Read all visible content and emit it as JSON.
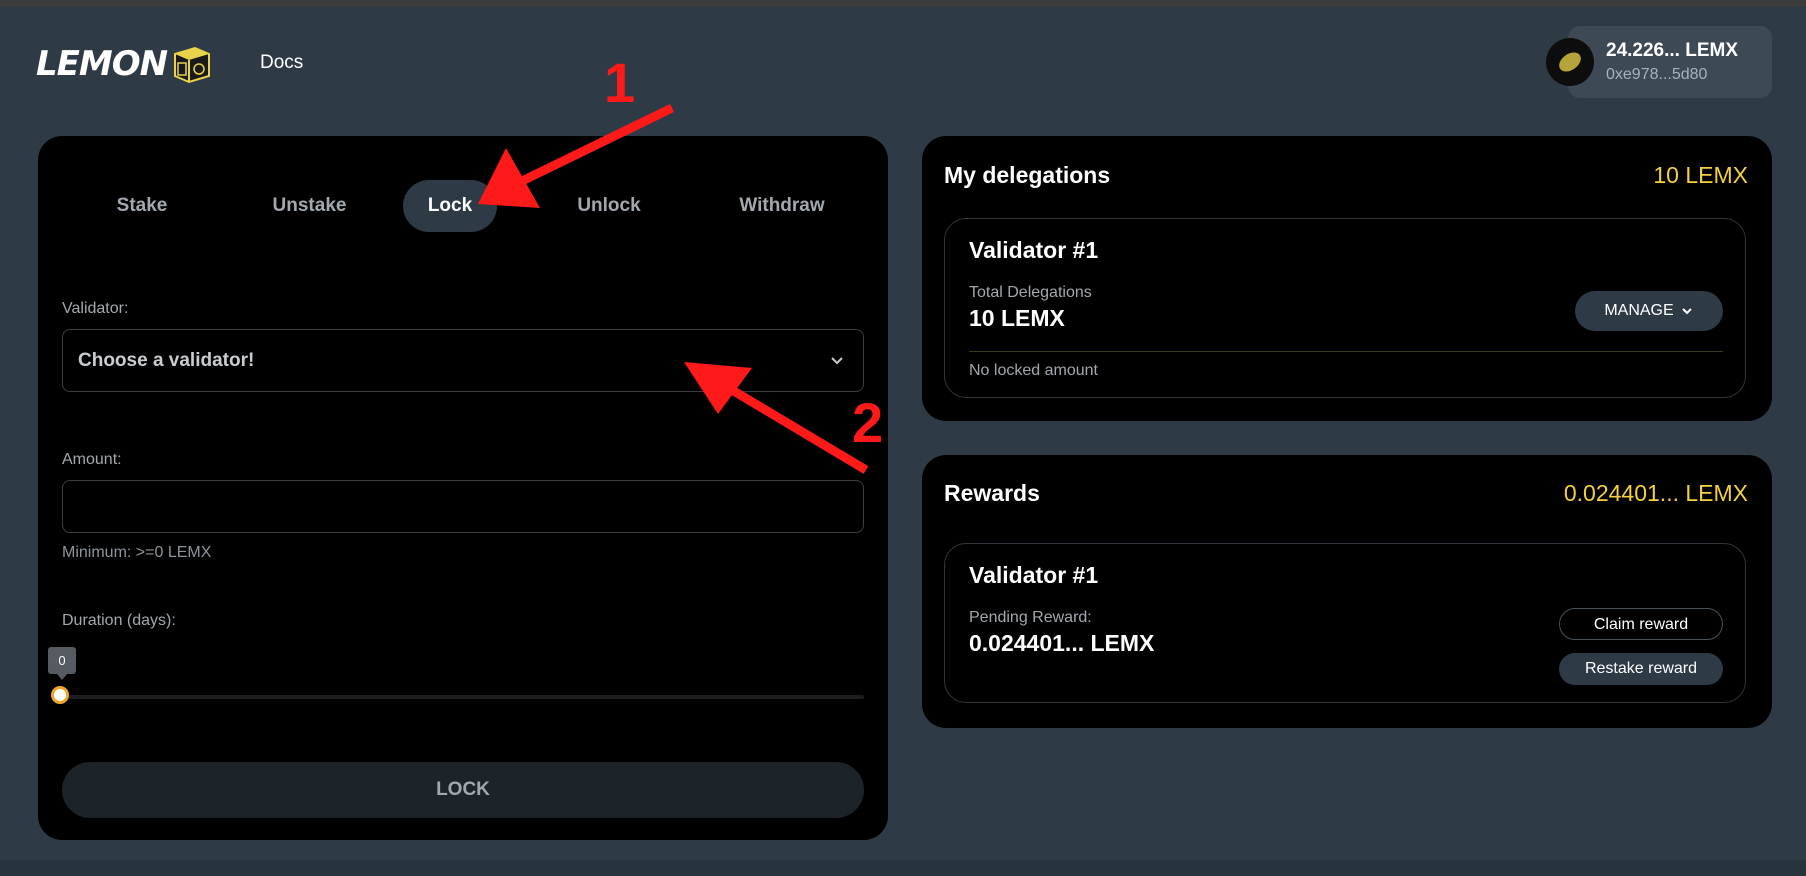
{
  "header": {
    "logo_text": "LEMON",
    "docs_label": "Docs",
    "wallet": {
      "balance": "24.226... LEMX",
      "address": "0xe978...5d80"
    }
  },
  "tabs": [
    {
      "label": "Stake",
      "active": false
    },
    {
      "label": "Unstake",
      "active": false
    },
    {
      "label": "Lock",
      "active": true
    },
    {
      "label": "Unlock",
      "active": false
    },
    {
      "label": "Withdraw",
      "active": false
    }
  ],
  "form": {
    "validator_label": "Validator:",
    "validator_placeholder": "Choose a validator!",
    "amount_label": "Amount:",
    "amount_value": "",
    "amount_hint": "Minimum: >=0 LEMX",
    "duration_label": "Duration (days):",
    "duration_value": "0",
    "submit_label": "LOCK"
  },
  "delegations": {
    "title": "My delegations",
    "total": "10 LEMX",
    "card": {
      "validator": "Validator #1",
      "total_label": "Total Delegations",
      "total_value": "10 LEMX",
      "manage_label": "MANAGE",
      "locked_text": "No locked amount"
    }
  },
  "rewards": {
    "title": "Rewards",
    "total": "0.024401... LEMX",
    "card": {
      "validator": "Validator #1",
      "pending_label": "Pending Reward:",
      "pending_value": "0.024401... LEMX",
      "claim_label": "Claim reward",
      "restake_label": "Restake reward"
    }
  },
  "annotations": {
    "arrow1_label": "1",
    "arrow2_label": "2"
  },
  "colors": {
    "background": "#2e3b46",
    "panel": "#000000",
    "accent": "#f4d03f",
    "annotation": "#ff1a1a"
  }
}
